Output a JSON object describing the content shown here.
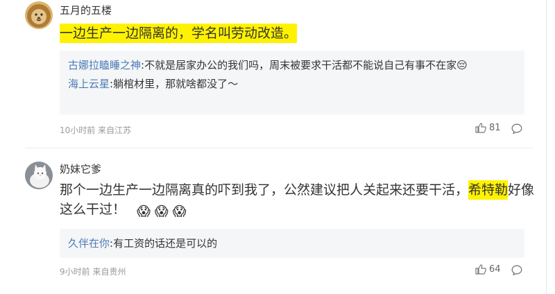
{
  "comments": [
    {
      "username": "五月的五楼",
      "body_highlight": "一边生产一边隔离的，学名叫劳动改造。",
      "replies": [
        {
          "name": "古娜拉瞌睡之神",
          "text": ":不就是居家办公的我们吗，周末被要求干活都不能说自己有事不在家",
          "emoji": "😔"
        },
        {
          "name": "海上云星",
          "text": ":躺棺材里，那就啥都没了～"
        }
      ],
      "time": "10小时前",
      "location": "来自江苏",
      "likes": "81"
    },
    {
      "username": "奶妹它爹",
      "body_before": "那个一边生产一边隔离真的吓到我了，公然建议把人关起来还要干活，",
      "body_highlight": "希特勒",
      "body_after": "好像这么干过！",
      "emojis": [
        "😱",
        "😱",
        "😱"
      ],
      "replies": [
        {
          "name": "久伴在你",
          "text": ":有工资的话还是可以的"
        }
      ],
      "time": "9小时前",
      "location": "来自贵州",
      "likes": "64"
    }
  ],
  "colors": {
    "highlight": "#fff200",
    "reply_name": "#4a7ab5",
    "meta": "#999999"
  }
}
